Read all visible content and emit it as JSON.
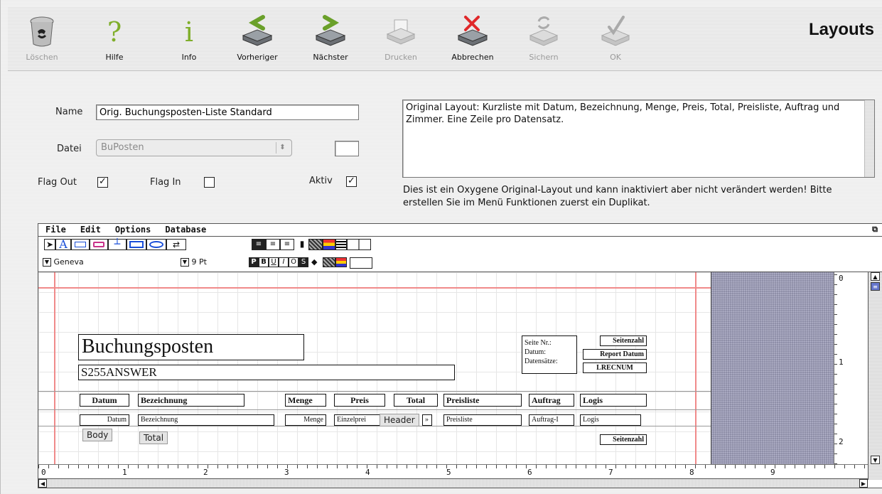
{
  "toolbar": {
    "title": "Layouts",
    "buttons": [
      {
        "label": "Löschen",
        "icon": "trash-icon",
        "enabled": false
      },
      {
        "label": "Hilfe",
        "icon": "help-icon",
        "enabled": true
      },
      {
        "label": "Info",
        "icon": "info-icon",
        "enabled": true
      },
      {
        "label": "Vorheriger",
        "icon": "previous-icon",
        "enabled": true
      },
      {
        "label": "Nächster",
        "icon": "next-icon",
        "enabled": true
      },
      {
        "label": "Drucken",
        "icon": "printer-icon",
        "enabled": false
      },
      {
        "label": "Abbrechen",
        "icon": "cancel-icon",
        "enabled": true
      },
      {
        "label": "Sichern",
        "icon": "save-icon",
        "enabled": false
      },
      {
        "label": "OK",
        "icon": "ok-icon",
        "enabled": false
      }
    ]
  },
  "form": {
    "name_label": "Name",
    "name_value": "Orig. Buchungsposten-Liste Standard",
    "datei_label": "Datei",
    "datei_value": "BuPosten",
    "flag_out_label": "Flag Out",
    "flag_out_checked": true,
    "flag_in_label": "Flag In",
    "flag_in_checked": false,
    "aktiv_label": "Aktiv",
    "aktiv_checked": true,
    "description": "Original Layout: Kurzliste mit Datum, Bezeichnung, Menge, Preis, Total, Preisliste, Auftrag und Zimmer. Eine Zeile pro Datensatz.",
    "note": "Dies ist ein Oxygene Original-Layout und kann inaktiviert aber nicht verändert werden! Bitte erstellen Sie im Menü Funktionen zuerst ein Duplikat."
  },
  "editor": {
    "menu": [
      "File",
      "Edit",
      "Options",
      "Database"
    ],
    "font_name": "Geneva",
    "font_size": "9 Pt",
    "style_buttons": [
      "P",
      "B",
      "U",
      "I",
      "O",
      "S"
    ],
    "title_field": "Buchungsposten",
    "subtitle_field": "S255ANSWER",
    "page_labels": [
      "Seite Nr.:",
      "Datum:",
      "Datensätze:"
    ],
    "page_fields": [
      "Seitenzahl",
      "Report Datum",
      "LRECNUM"
    ],
    "header_columns": [
      "Datum",
      "Bezeichnung",
      "Menge",
      "Preis",
      "Total",
      "Preisliste",
      "Auftrag",
      "Logis"
    ],
    "body_fields": [
      "Datum",
      "Bezeichnung",
      "Menge",
      "Einzelprei",
      "Preisliste",
      "Auftrag-I",
      "Logis"
    ],
    "body_extra": "»",
    "section_tabs": {
      "header": "Header",
      "body": "Body",
      "total": "Total"
    },
    "footer_field": "Seitenzahl",
    "h_ruler": [
      "0",
      "1",
      "2",
      "3",
      "4",
      "5",
      "6",
      "7",
      "8",
      "9"
    ],
    "v_ruler": [
      "0",
      "1",
      "2"
    ]
  }
}
